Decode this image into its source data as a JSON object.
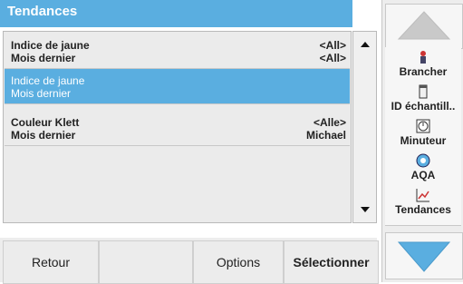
{
  "title": "Tendances",
  "list": {
    "items": [
      {
        "line1": "Indice de jaune",
        "line2": "Mois dernier",
        "right1": "<All>",
        "right2": "<All>"
      },
      {
        "line1": "Indice de jaune",
        "line2": "Mois dernier",
        "right1": "",
        "right2": ""
      },
      {
        "line1": "Couleur Klett",
        "line2": "Mois dernier",
        "right1": "<Alle>",
        "right2": "Michael"
      }
    ]
  },
  "sidebar": {
    "buttons": [
      {
        "label": "Brancher",
        "icon": "person-icon"
      },
      {
        "label": "ID échantill..",
        "icon": "sample-bottle-icon"
      },
      {
        "label": "Minuteur",
        "icon": "timer-icon"
      },
      {
        "label": "AQA",
        "icon": "aqa-icon"
      },
      {
        "label": "Tendances",
        "icon": "trend-chart-icon"
      }
    ]
  },
  "bottom": {
    "back": "Retour",
    "options": "Options",
    "select": "Sélectionner"
  },
  "colors": {
    "accent": "#5aaee0",
    "panel": "#ebebeb"
  }
}
